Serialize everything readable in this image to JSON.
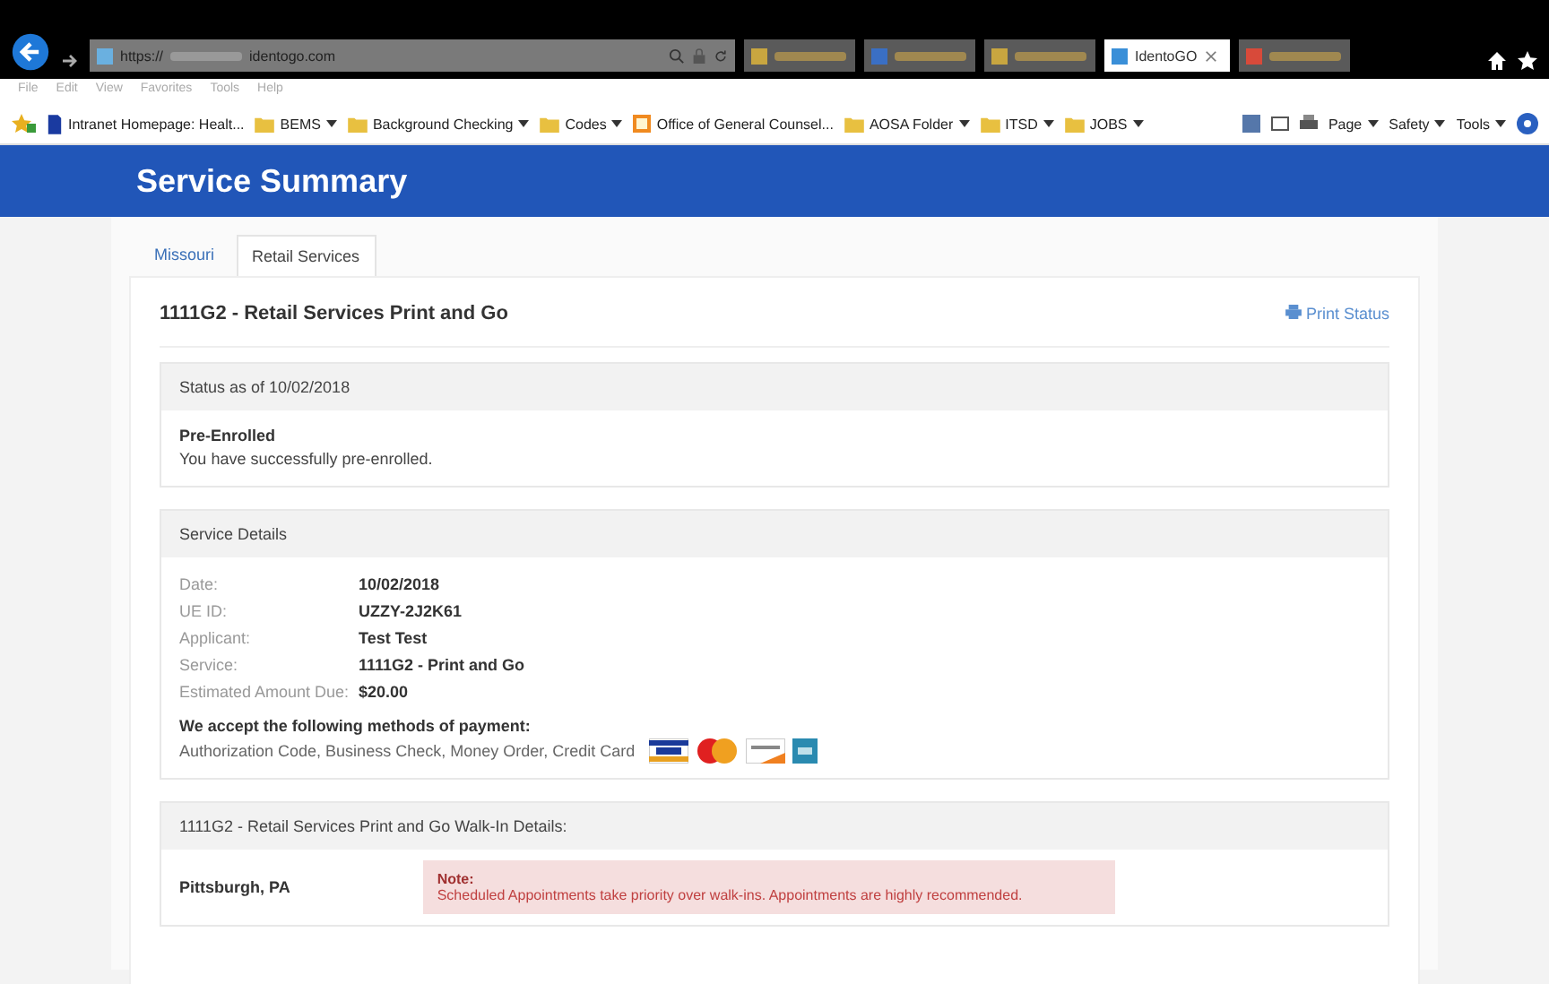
{
  "browser": {
    "address": {
      "scheme": "https://",
      "host": "identogo.com"
    },
    "tabs": [
      {
        "selected": false,
        "color": "#c8a640"
      },
      {
        "selected": false,
        "color": "#3a6fc4"
      },
      {
        "selected": false,
        "color": "#c8a640"
      },
      {
        "label": "IdentoGO",
        "selected": true,
        "color": "#3a8fd8"
      },
      {
        "selected": false,
        "color": "#d84a3a"
      }
    ],
    "menu": [
      "File",
      "Edit",
      "View",
      "Favorites",
      "Tools",
      "Help"
    ],
    "favorites": [
      {
        "label": "Intranet Homepage: Healt...",
        "kind": "page",
        "dropdown": false
      },
      {
        "label": "BEMS",
        "kind": "folder",
        "dropdown": true
      },
      {
        "label": "Background Checking",
        "kind": "folder",
        "dropdown": true
      },
      {
        "label": "Codes",
        "kind": "folder",
        "dropdown": true
      },
      {
        "label": "Office of General Counsel...",
        "kind": "site",
        "dropdown": false
      },
      {
        "label": "AOSA Folder",
        "kind": "folder",
        "dropdown": true
      },
      {
        "label": "ITSD",
        "kind": "folder",
        "dropdown": true
      },
      {
        "label": "JOBS",
        "kind": "folder",
        "dropdown": true
      }
    ],
    "commands": [
      "Page",
      "Safety",
      "Tools"
    ]
  },
  "header": {
    "title": "Service Summary"
  },
  "tabs": [
    {
      "label": "Missouri",
      "selected": false
    },
    {
      "label": "Retail Services",
      "selected": true
    }
  ],
  "card": {
    "title": "1111G2 - Retail Services Print and Go",
    "print_link": "Print Status",
    "status": {
      "heading": "Status as of 10/02/2018",
      "state": "Pre-Enrolled",
      "message": "You have successfully pre-enrolled."
    },
    "details": {
      "heading": "Service Details",
      "rows": [
        {
          "label": "Date:",
          "value": "10/02/2018"
        },
        {
          "label": "UE ID:",
          "value": "UZZY-2J2K61"
        },
        {
          "label": "Applicant:",
          "value": "Test Test"
        },
        {
          "label": "Service:",
          "value": "1111G2 - Print and Go"
        },
        {
          "label": "Estimated Amount Due:",
          "value": "$20.00"
        }
      ],
      "payment_heading": "We accept the following methods of payment:",
      "payment_methods": "Authorization Code, Business Check, Money Order, Credit Card",
      "cards": [
        {
          "kind": "visa"
        },
        {
          "kind": "mastercard"
        },
        {
          "kind": "discover"
        },
        {
          "kind": "amex"
        }
      ]
    },
    "walkin": {
      "heading": "1111G2 - Retail Services Print and Go Walk-In Details:",
      "location": "Pittsburgh, PA",
      "note_title": "Note:",
      "note": "Scheduled Appointments take priority over walk-ins. Appointments are highly recommended."
    }
  }
}
